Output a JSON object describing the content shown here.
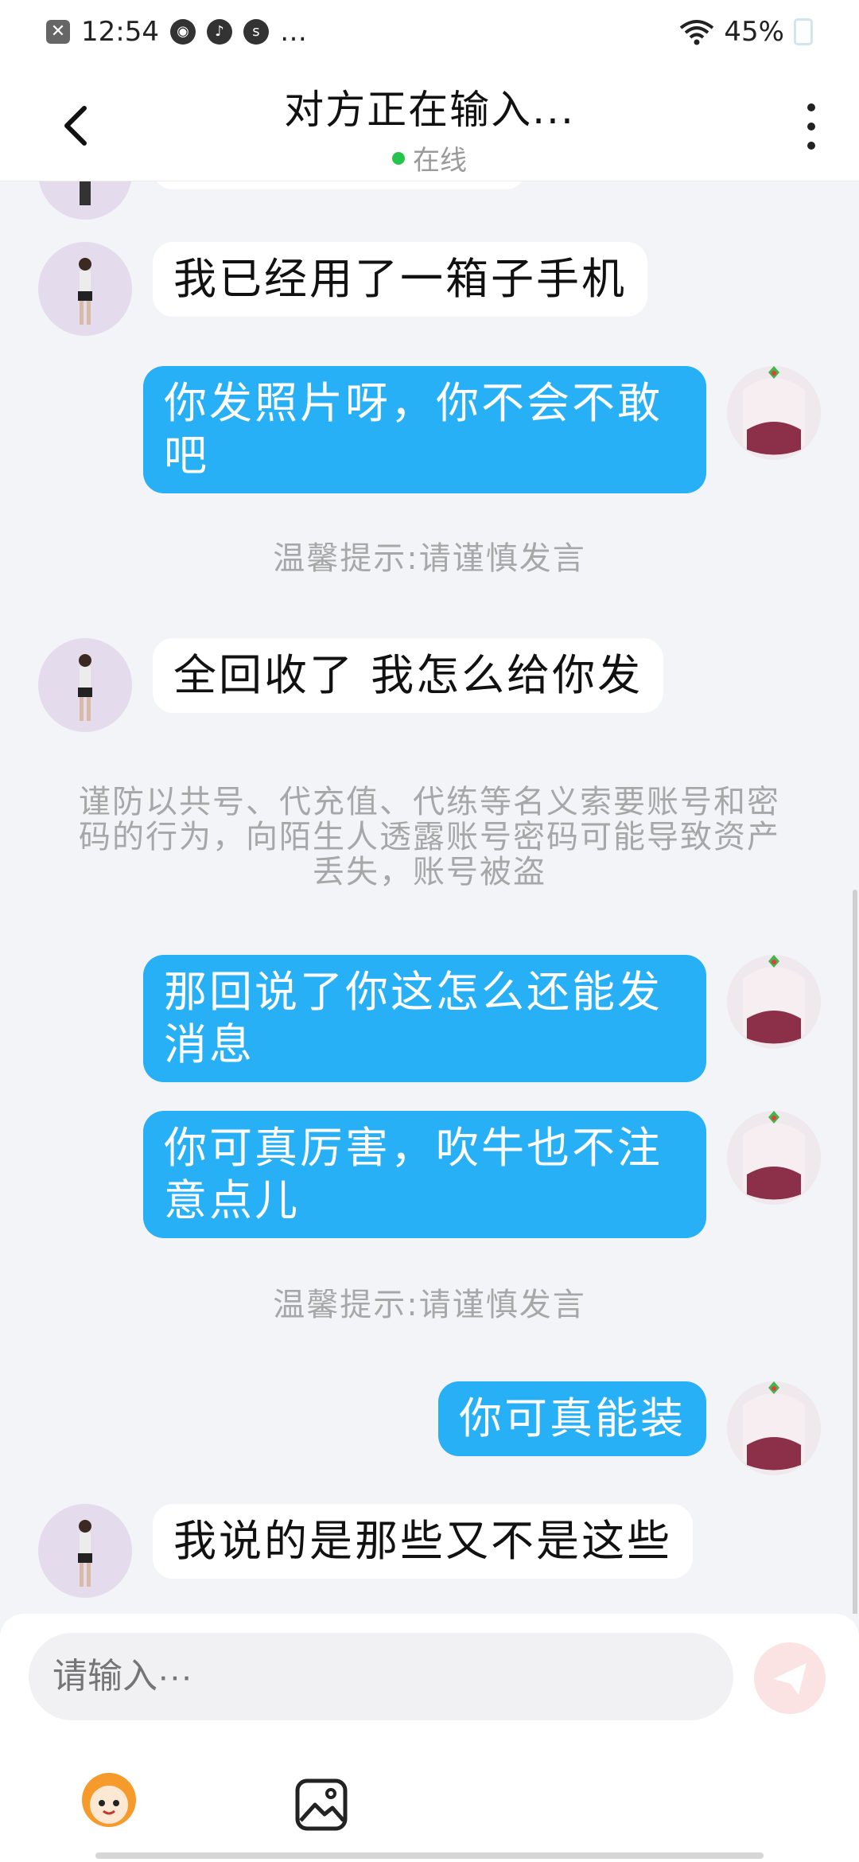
{
  "status_bar": {
    "time": "12:54",
    "extra": "…",
    "battery": "45%"
  },
  "header": {
    "title": "对方正在输入...",
    "status": "在线"
  },
  "messages": [
    {
      "side": "left",
      "text": "我已经用了一箱子手机"
    },
    {
      "side": "right",
      "text": "你发照片呀，你不会不敢吧"
    },
    {
      "side": "notice",
      "text": "温馨提示:请谨慎发言"
    },
    {
      "side": "left",
      "text": "全回收了 我怎么给你发"
    },
    {
      "side": "notice",
      "text": "谨防以共号、代充值、代练等名义索要账号和密码的行为，向陌生人透露账号密码可能导致资产丢失，账号被盗"
    },
    {
      "side": "right",
      "text": "那回说了你这怎么还能发消息"
    },
    {
      "side": "right",
      "text": "你可真厉害，吹牛也不注意点儿"
    },
    {
      "side": "notice",
      "text": "温馨提示:请谨慎发言"
    },
    {
      "side": "right",
      "text": "你可真能装"
    },
    {
      "side": "left",
      "text": "我说的是那些又不是这些"
    }
  ],
  "input": {
    "placeholder": "请输入···"
  },
  "colors": {
    "accent_bubble": "#27b0f5",
    "online": "#27c44b",
    "send_disabled": "#fbe3e3"
  },
  "icons": [
    "back-icon",
    "more-icon",
    "send-icon",
    "emoji-icon",
    "image-icon"
  ]
}
